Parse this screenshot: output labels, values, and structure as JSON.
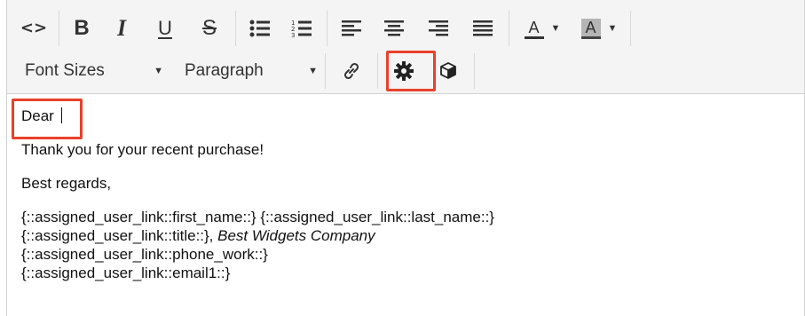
{
  "toolbar": {
    "row1": {
      "source_icon": "code-icon",
      "bold_glyph": "B",
      "italic_glyph": "I",
      "underline_glyph": "U",
      "strike_glyph": "S",
      "bullet_list_icon": "bullet-list-icon",
      "numbered_list_icon": "numbered-list-icon",
      "align_left_icon": "align-left-icon",
      "align_center_icon": "align-center-icon",
      "align_right_icon": "align-right-icon",
      "align_justify_icon": "align-justify-icon",
      "text_color_glyph": "A",
      "bg_color_glyph": "A"
    },
    "row2": {
      "font_sizes_label": "Font Sizes",
      "paragraph_label": "Paragraph",
      "link_icon": "link-icon",
      "settings_icon": "gear-icon",
      "template_icon": "cube-icon"
    }
  },
  "content": {
    "greeting": "Dear ",
    "line1": "Thank you for your recent purchase!",
    "line2": "Best regards,",
    "signature": {
      "name_line": "{::assigned_user_link::first_name::} {::assigned_user_link::last_name::}",
      "title_prefix": "{::assigned_user_link::title::}, ",
      "company": "Best Widgets Company",
      "phone": "{::assigned_user_link::phone_work::}",
      "email": "{::assigned_user_link::email1::}"
    }
  },
  "colors": {
    "highlight": "#e8412b",
    "toolbar_bg": "#f4f4f4",
    "border": "#d2d2d2"
  }
}
